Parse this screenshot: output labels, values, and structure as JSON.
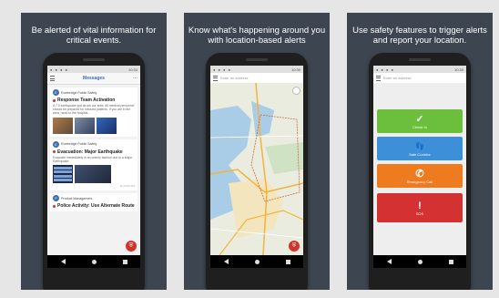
{
  "panels": [
    {
      "caption": "Be alerted of vital information for critical events."
    },
    {
      "caption": "Know what's happening around you with location-based alerts"
    },
    {
      "caption": "Use safety features to trigger alerts and report your location."
    }
  ],
  "status_bar": {
    "time": "10:30"
  },
  "messages_screen": {
    "header_title": "Messages",
    "cards": [
      {
        "avatar_letter": "E",
        "sender": "Everbridge Public Safety",
        "title": "Response Team Activation",
        "body": "A 7.0 earthquake just struck our area. All medical personnel should be prepared for inbound patients. If you are in the area, head to the hospital..."
      },
      {
        "avatar_letter": "E",
        "sender": "Everbridge Public Safety",
        "title": "Evacuation: Major Earthquake",
        "body": "Evacuate immediately in an orderly fashion due to a Major Earthquake.",
        "timestamp": "11:23:09 AM"
      },
      {
        "avatar_letter": "P",
        "sender": "Product Management",
        "title": "Police Activity: Use Alternate Route"
      }
    ]
  },
  "map_screen": {
    "search_placeholder": "Enter an address"
  },
  "safety_screen": {
    "search_placeholder": "Enter an address",
    "buttons": [
      {
        "label": "Check In",
        "glyph": "✓"
      },
      {
        "label": "Safe Corridor",
        "glyph": "👣"
      },
      {
        "label": "Emergency Call",
        "glyph": "✆"
      },
      {
        "label": "SOS",
        "glyph": "!"
      }
    ]
  },
  "colors": {
    "panel_bg": "#3d4650",
    "check_in": "#6cbf3c",
    "safe_corridor": "#3d8fd8",
    "emergency_call": "#ef7b21",
    "sos": "#d43232"
  }
}
